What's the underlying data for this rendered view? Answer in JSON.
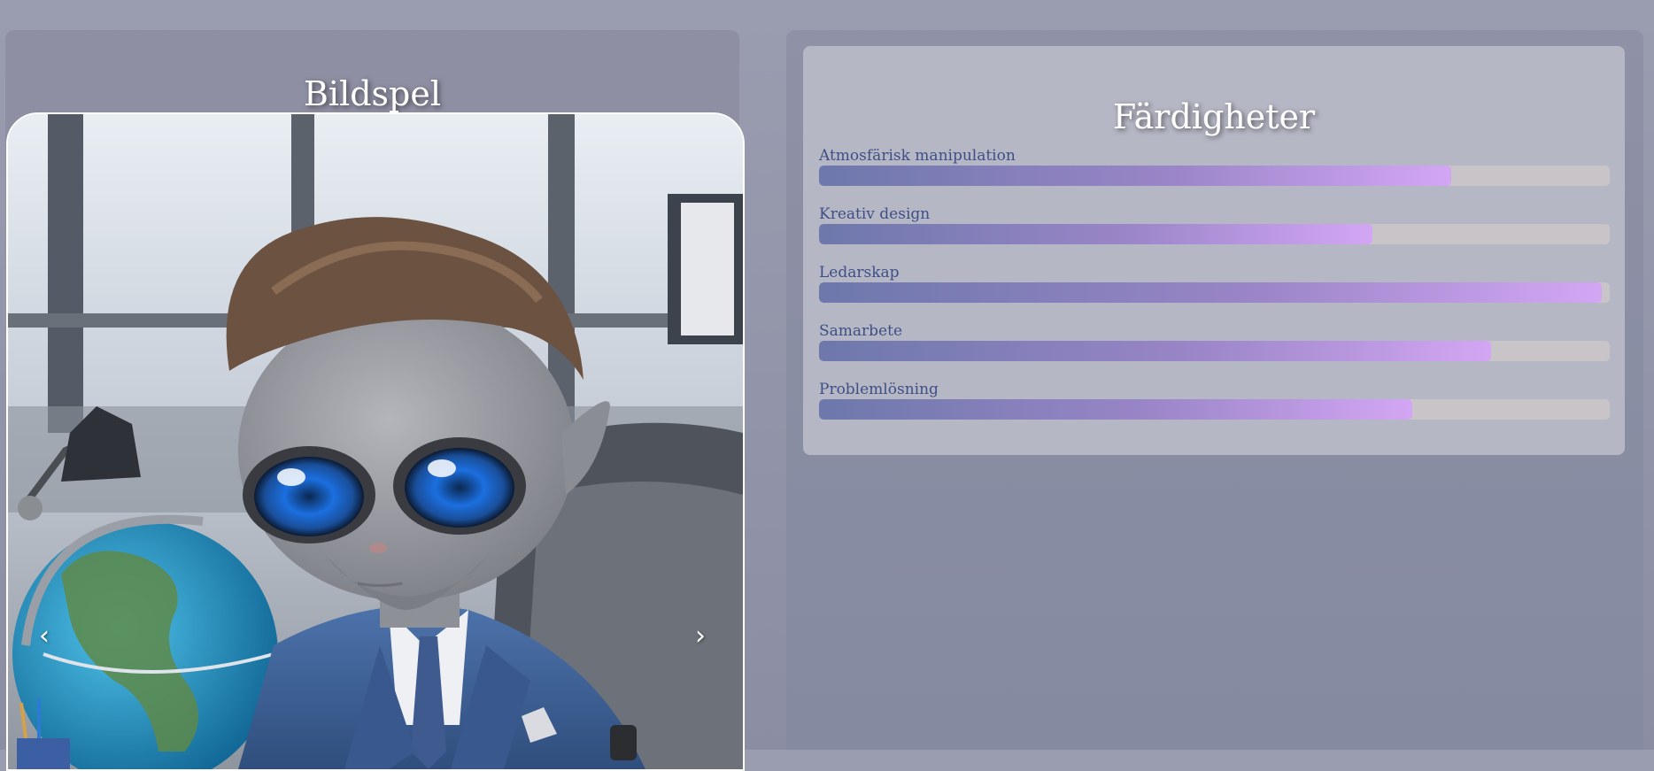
{
  "slideshow": {
    "title": "Bildspel",
    "prev_icon": "chevron-left-icon",
    "next_icon": "chevron-right-icon",
    "prev_glyph": "‹",
    "next_glyph": "›"
  },
  "skills": {
    "title": "Färdigheter",
    "items": [
      {
        "label": "Atmosfärisk manipulation",
        "level": 0.8
      },
      {
        "label": "Kreativ design",
        "level": 0.7
      },
      {
        "label": "Ledarskap",
        "level": 0.99
      },
      {
        "label": "Samarbete",
        "level": 0.85
      },
      {
        "label": "Problemlösning",
        "level": 0.75
      }
    ]
  },
  "colors": {
    "bar_start": "#6d78ab",
    "bar_end": "#d3a6f4",
    "label": "#3d4f86"
  }
}
